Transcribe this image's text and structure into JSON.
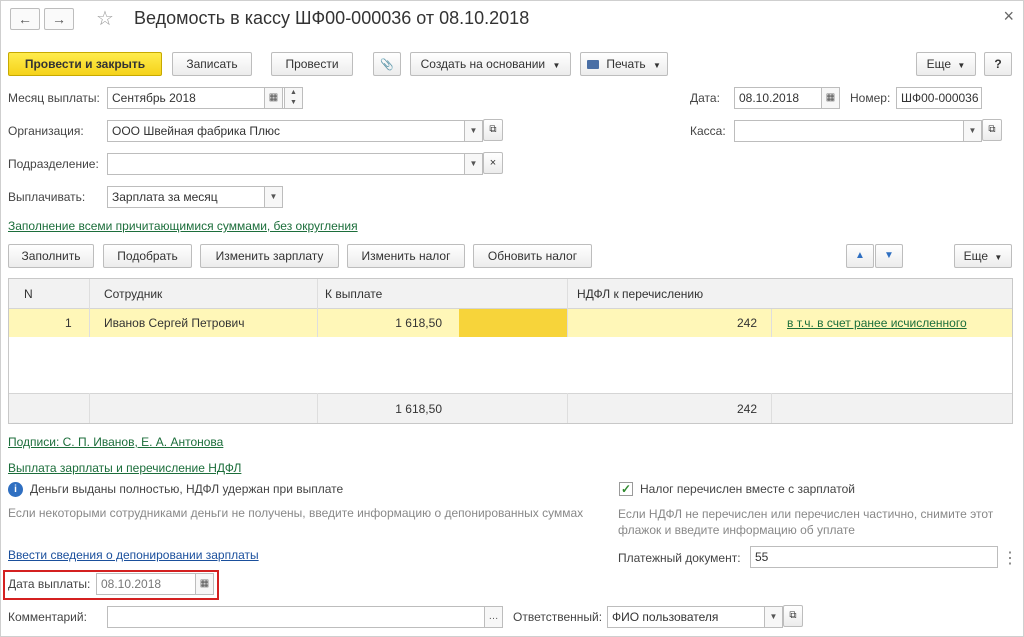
{
  "header": {
    "back_icon": "←",
    "forward_icon": "→",
    "star_icon": "☆",
    "title": "Ведомость в кассу ШФ00-000036 от 08.10.2018",
    "close_icon": "×"
  },
  "toolbar": {
    "post_close": "Провести и закрыть",
    "save": "Записать",
    "post": "Провести",
    "clip_icon": "📎",
    "create_based": "Создать на основании",
    "print": "Печать",
    "more": "Еще",
    "help": "?"
  },
  "form": {
    "month_label": "Месяц выплаты:",
    "month_value": "Сентябрь 2018",
    "date_label": "Дата:",
    "date_value": "08.10.2018",
    "number_label": "Номер:",
    "number_value": "ШФ00-000036",
    "org_label": "Организация:",
    "org_value": "ООО Швейная фабрика Плюс",
    "kassa_label": "Касса:",
    "kassa_value": "",
    "dept_label": "Подразделение:",
    "dept_value": "",
    "pay_label": "Выплачивать:",
    "pay_value": "Зарплата за месяц",
    "fill_link": "Заполнение всеми причитающимися суммами, без округления"
  },
  "table_toolbar": {
    "fill": "Заполнить",
    "select": "Подобрать",
    "change_salary": "Изменить зарплату",
    "change_tax": "Изменить налог",
    "update_tax": "Обновить налог",
    "up_icon": "▲",
    "down_icon": "▼",
    "more": "Еще"
  },
  "table": {
    "headers": [
      "N",
      "Сотрудник",
      "К выплате",
      "НДФЛ к перечислению"
    ],
    "rows": [
      {
        "n": "1",
        "employee": "Иванов Сергей Петрович",
        "amount": "1 618,50",
        "tax": "242",
        "link": "в т.ч. в счет ранее исчисленного"
      }
    ],
    "total_amount": "1 618,50",
    "total_tax": "242"
  },
  "bottom": {
    "signatures_link": "Подписи: С. П. Иванов, Е. А. Антонова",
    "payment_link": "Выплата зарплаты и перечисление НДФЛ",
    "info_icon": "i",
    "info_text": "Деньги выданы полностью, НДФЛ удержан при выплате",
    "info_hint": "Если некоторыми сотрудниками деньги не получены, введите информацию о депонированных суммах",
    "tax_checkbox_label": "Налог перечислен вместе с зарплатой",
    "tax_hint_1": "Если НДФЛ не перечислен или перечислен частично, снимите этот",
    "tax_hint_2": "флажок и введите информацию об уплате",
    "deposit_link": "Ввести сведения о депонировании зарплаты",
    "pay_doc_label": "Платежный документ:",
    "pay_doc_value": "55",
    "pay_date_label": "Дата выплаты:",
    "pay_date_value": "08.10.2018",
    "comment_label": "Комментарий:",
    "comment_value": "",
    "responsible_label": "Ответственный:",
    "responsible_value": "ФИО пользователя"
  },
  "colors": {
    "primary_button": "#f5d21a",
    "highlight_row": "#fff7b8",
    "link_green": "#1c6e3b",
    "annotation_red": "#d42020"
  }
}
